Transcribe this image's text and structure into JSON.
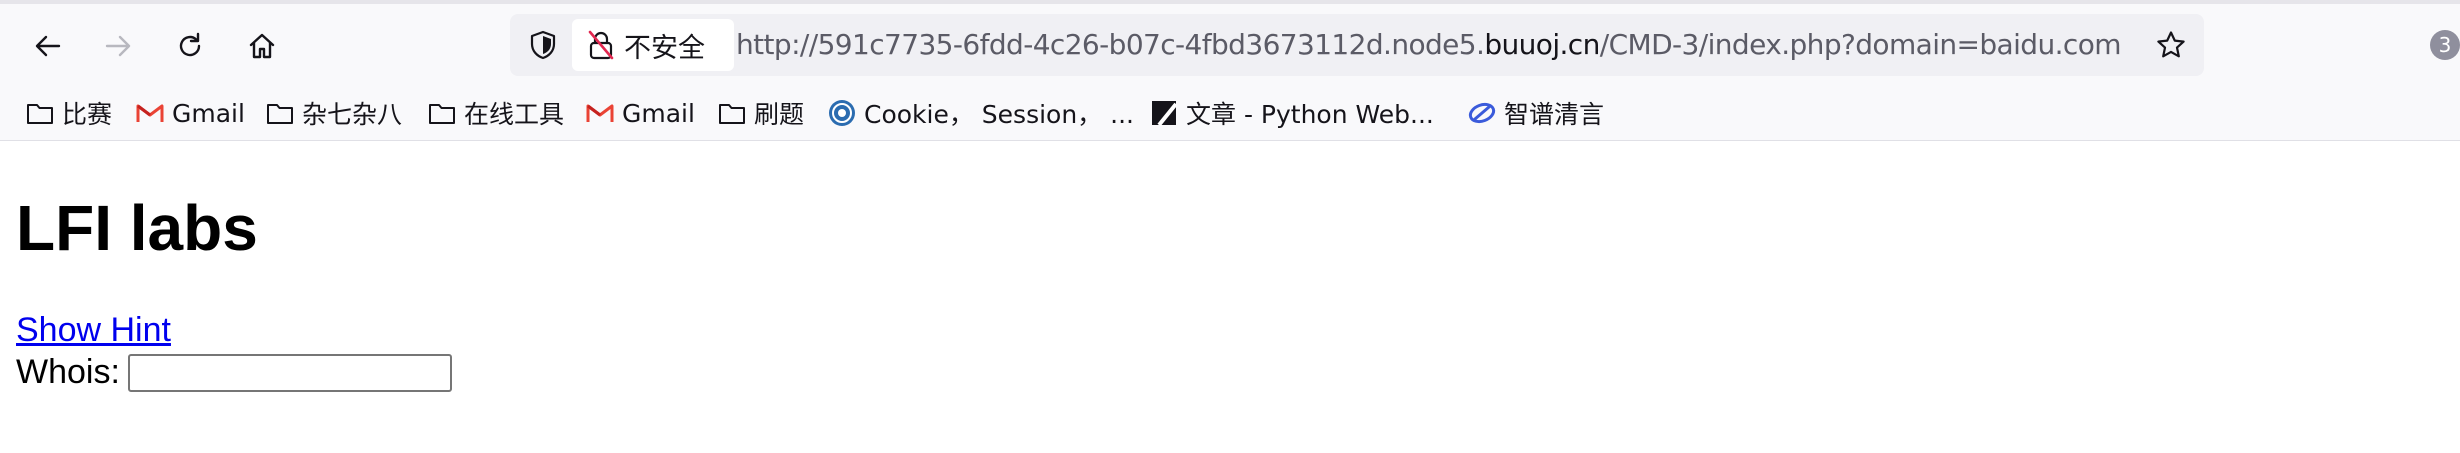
{
  "browser": {
    "insecure_label": "不安全",
    "url": {
      "prefix": "http://591c7735-6fdd-4c26-b07c-4fbd3673112d.node5.",
      "domain": "buuoj.cn",
      "suffix": "/CMD-3/index.php?domain=baidu.com"
    },
    "extension_badge": "3",
    "colors": {
      "toolbar_bg": "#f9f9fb",
      "urlbar_bg": "#f0f0f4",
      "url_dim": "#5b5b66",
      "gmail_red": "#ea4335",
      "zhipu_blue": "#3b5bdb"
    }
  },
  "bookmarks": [
    {
      "label": "比赛",
      "icon": "folder-icon"
    },
    {
      "label": "Gmail",
      "icon": "gmail-icon"
    },
    {
      "label": "杂七杂八",
      "icon": "folder-icon"
    },
    {
      "label": "在线工具",
      "icon": "folder-icon"
    },
    {
      "label": "Gmail",
      "icon": "gmail-icon"
    },
    {
      "label": "刷题",
      "icon": "folder-icon"
    },
    {
      "label": "Cookie，  Session，  ...",
      "icon": "site-icon"
    },
    {
      "label": "文章 - Python Web...",
      "icon": "zhihu-slash-icon"
    },
    {
      "label": "智谱清言",
      "icon": "zhipu-icon"
    }
  ],
  "page": {
    "title": "LFI labs",
    "hint_link": "Show Hint",
    "whois_label": "Whois:",
    "whois_value": "",
    "whois_placeholder": ""
  }
}
